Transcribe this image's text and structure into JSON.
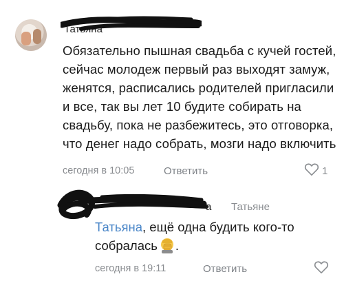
{
  "comments": [
    {
      "author": "Татьяна",
      "text": "Обязательно пышная свадьба с кучей гостей, сейчас молодеж первый раз выходят замуж, женятся, расписались родителей пригласили и все, так вы лет 10 будите собирать на свадьбу, пока не разбежитесь, это отговорка, что денег надо собрать, мозги надо включить",
      "time": "сегодня в 10:05",
      "reply_label": "Ответить",
      "likes": "1"
    },
    {
      "author_suffix": "а",
      "reply_to": "Татьяне",
      "mention": "Татьяна",
      "text_line1_rest": ", ещё одна будить кого-то",
      "text_line2": "собралась",
      "text_tail": ".",
      "emoji": "facepalm-emoji",
      "time": "сегодня в 19:11",
      "reply_label": "Ответить"
    }
  ],
  "colors": {
    "mention": "#4a86c8",
    "meta": "#8a8d91",
    "scribble": "#111111"
  }
}
